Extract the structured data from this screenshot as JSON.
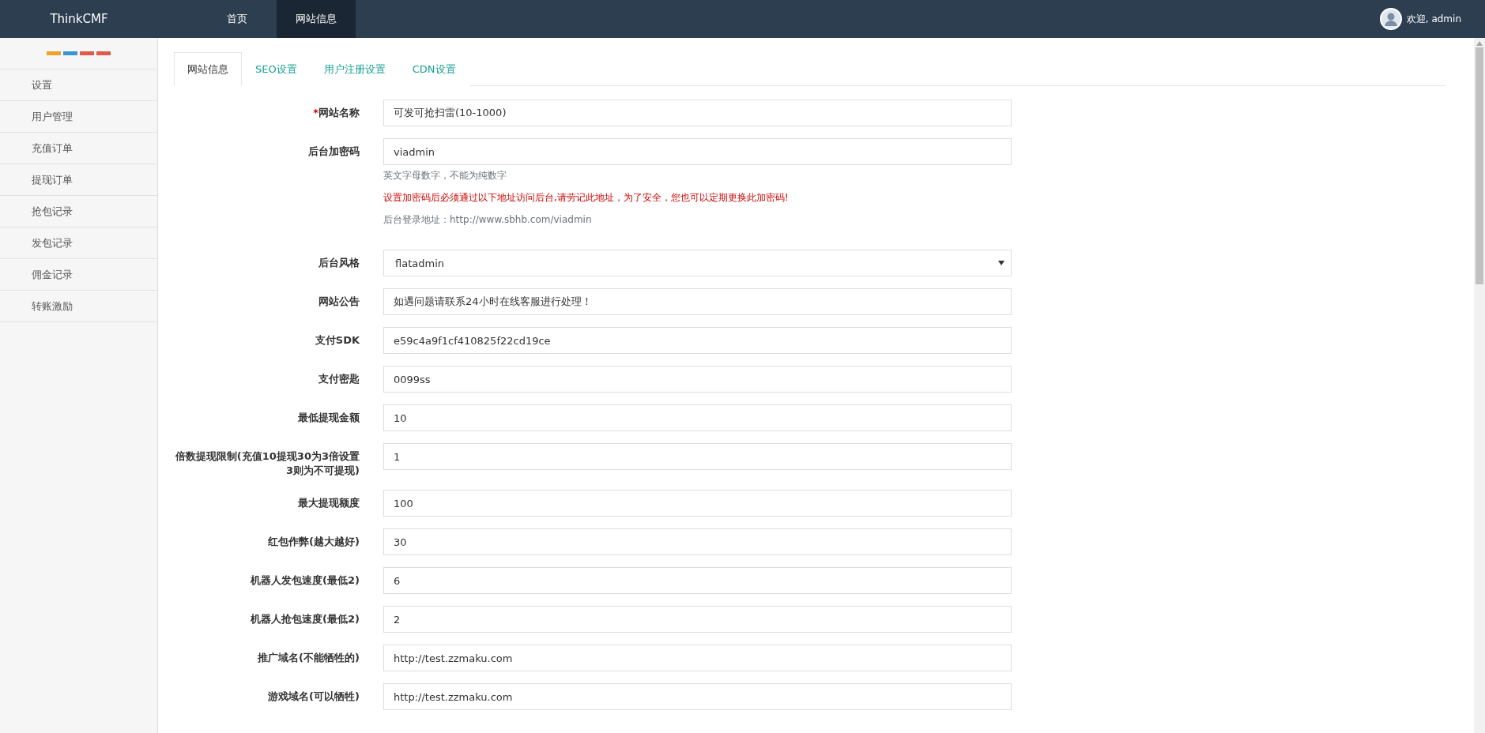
{
  "topbar": {
    "brand": "ThinkCMF",
    "nav": [
      {
        "label": "首页",
        "selected": false
      },
      {
        "label": "网站信息",
        "selected": true
      }
    ],
    "user": {
      "greeting": "欢迎, admin"
    }
  },
  "sidebar": {
    "color_bars": [
      {
        "color": "#f0a02c"
      },
      {
        "color": "#3a96d0"
      },
      {
        "color": "#e05a4b"
      },
      {
        "color": "#e05a4b"
      }
    ],
    "items": [
      {
        "label": "设置"
      },
      {
        "label": "用户管理"
      },
      {
        "label": "充值订单"
      },
      {
        "label": "提现订单"
      },
      {
        "label": "抢包记录"
      },
      {
        "label": "发包记录"
      },
      {
        "label": "佣金记录"
      },
      {
        "label": "转账激励"
      }
    ]
  },
  "tabs": [
    {
      "label": "网站信息",
      "selected": true
    },
    {
      "label": "SEO设置",
      "selected": false
    },
    {
      "label": "用户注册设置",
      "selected": false
    },
    {
      "label": "CDN设置",
      "selected": false
    }
  ],
  "form": [
    {
      "label": "网站名称",
      "required_mark": "*",
      "kind": "text",
      "value": "可发可抢扫雷(10-1000)"
    },
    {
      "label": "后台加密码",
      "kind": "text",
      "value": "viadmin",
      "help": [
        {
          "kind": "hint",
          "text": "英文字母数字，不能为纯数字"
        },
        {
          "kind": "warning",
          "text": "设置加密码后必须通过以下地址访问后台,请劳记此地址，为了安全，您也可以定期更换此加密码!"
        },
        {
          "kind": "hint",
          "text": "后台登录地址：http://www.sbhb.com/viadmin"
        }
      ]
    },
    {
      "label": "后台风格",
      "kind": "select",
      "value": "flatadmin"
    },
    {
      "label": "网站公告",
      "kind": "text",
      "value": "如遇问题请联系24小时在线客服进行处理！"
    },
    {
      "label": "支付SDK",
      "kind": "text",
      "value": "e59c4a9f1cf410825f22cd19ce"
    },
    {
      "label": "支付密匙",
      "kind": "text",
      "value": "0099ss"
    },
    {
      "label": "最低提现金额",
      "kind": "text",
      "value": "10"
    },
    {
      "label": "倍数提现限制(充值10提现30为3倍设置3则为不可提现)",
      "kind": "text",
      "value": "1"
    },
    {
      "label": "最大提现额度",
      "kind": "text",
      "value": "100"
    },
    {
      "label": "红包作弊(越大越好)",
      "kind": "text",
      "value": "30"
    },
    {
      "label": "机器人发包速度(最低2)",
      "kind": "text",
      "value": "6"
    },
    {
      "label": "机器人抢包速度(最低2)",
      "kind": "text",
      "value": "2"
    },
    {
      "label": "推广域名(不能牺牲的)",
      "kind": "text",
      "value": "http://test.zzmaku.com"
    },
    {
      "label": "游戏域名(可以牺牲)",
      "kind": "text",
      "value": "http://test.zzmaku.com"
    }
  ]
}
